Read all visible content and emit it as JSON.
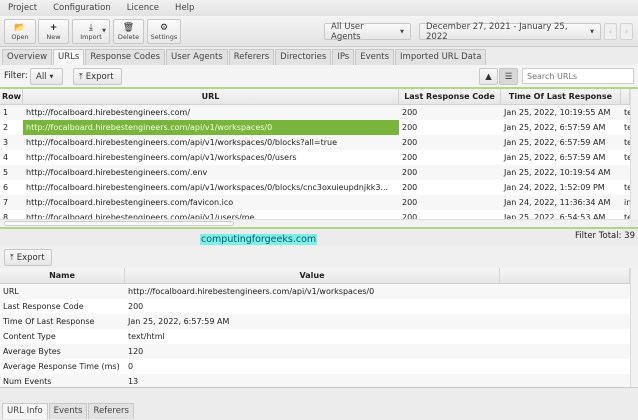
{
  "menu": [
    "Project",
    "Configuration",
    "Licence",
    "Help"
  ],
  "toolbar": {
    "open": "Open",
    "new": "New",
    "import": "Import",
    "delete": "Delete",
    "settings": "Settings",
    "user_agents": "All User Agents",
    "date_range": "December 27, 2021 - January 25, 2022"
  },
  "tabs": [
    "Overview",
    "URLs",
    "Response Codes",
    "User Agents",
    "Referers",
    "Directories",
    "IPs",
    "Events",
    "Imported URL Data"
  ],
  "filter": {
    "label": "Filter:",
    "value": "All",
    "export": "Export",
    "search_placeholder": "Search URLs"
  },
  "urls_table": {
    "headers": [
      "Row",
      "URL",
      "Last Response Code",
      "Time Of Last Response"
    ],
    "rows": [
      [
        "1",
        "http://focalboard.hirebestengineers.com/",
        "200",
        "Jan 25, 2022, 10:19:55 AM",
        "te"
      ],
      [
        "2",
        "http://focalboard.hirebestengineers.com/api/v1/workspaces/0",
        "200",
        "Jan 25, 2022, 6:57:59 AM",
        "te"
      ],
      [
        "3",
        "http://focalboard.hirebestengineers.com/api/v1/workspaces/0/blocks?all=true",
        "200",
        "Jan 25, 2022, 6:57:59 AM",
        "te"
      ],
      [
        "4",
        "http://focalboard.hirebestengineers.com/api/v1/workspaces/0/users",
        "200",
        "Jan 25, 2022, 6:57:59 AM",
        "te"
      ],
      [
        "5",
        "http://focalboard.hirebestengineers.com/.env",
        "200",
        "Jan 25, 2022, 10:19:54 AM",
        ""
      ],
      [
        "6",
        "http://focalboard.hirebestengineers.com/api/v1/workspaces/0/blocks/cnc3oxuieupdnjkk3...",
        "200",
        "Jan 24, 2022, 1:52:09 PM",
        "te"
      ],
      [
        "7",
        "http://focalboard.hirebestengineers.com/favicon.ico",
        "200",
        "Jan 24, 2022, 11:36:34 AM",
        "in"
      ],
      [
        "8",
        "http://focalboard.hirebestengineers.com/api/v1/users/me",
        "200",
        "Jan 25, 2022, 6:54:53 AM",
        "te"
      ]
    ],
    "selected_row": 1
  },
  "filter_total": "Filter Total: 39",
  "watermark": "computingforgeeks.com",
  "details": {
    "export": "Export",
    "headers": [
      "Name",
      "Value"
    ],
    "rows": [
      [
        "URL",
        "http://focalboard.hirebestengineers.com/api/v1/workspaces/0"
      ],
      [
        "Last Response Code",
        "200"
      ],
      [
        "Time Of Last Response",
        "Jan 25, 2022, 6:57:59 AM"
      ],
      [
        "Content Type",
        "text/html"
      ],
      [
        "Average Bytes",
        "120"
      ],
      [
        "Average Response Time (ms)",
        "0"
      ],
      [
        "Num Events",
        "13"
      ]
    ]
  },
  "bottom_tabs": [
    "URL Info",
    "Events",
    "Referers"
  ]
}
